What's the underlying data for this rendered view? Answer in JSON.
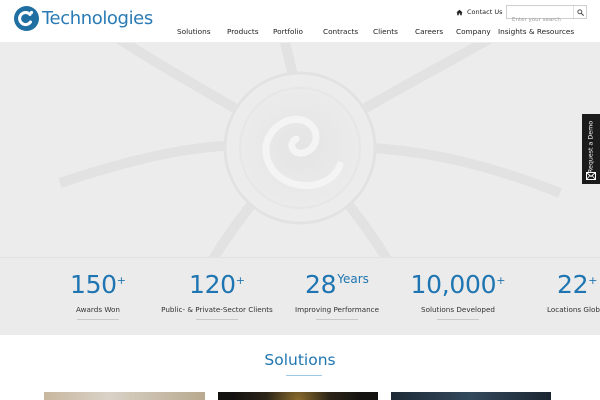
{
  "brand": {
    "name": "Technologies",
    "logo_icon": "ci-logo-mark",
    "color": "#2a7bb5"
  },
  "utility": {
    "contact_label": "Contact Us",
    "search_placeholder": "Enter your search",
    "search_icon": "magnifier"
  },
  "nav": {
    "items": [
      "Solutions",
      "Products",
      "Portfolio",
      "Contracts",
      "Clients",
      "Careers",
      "Company",
      "Insights & Resources"
    ]
  },
  "hero": {
    "background": "#ececec",
    "graphic": "turbine-fan-with-swirl"
  },
  "demo_tab": {
    "label": "Request a Demo",
    "icon": "mail-icon"
  },
  "stats": [
    {
      "number": "150",
      "suffix": "+",
      "label": "Awards Won"
    },
    {
      "number": "120",
      "suffix": "+",
      "label": "Public- & Private-Sector Clients"
    },
    {
      "number": "28",
      "suffix": "Years",
      "label": "Improving Performance"
    },
    {
      "number": "10,000",
      "suffix": "+",
      "label": "Solutions Developed"
    },
    {
      "number": "22",
      "suffix": "+",
      "label": "Locations Glob"
    }
  ],
  "solutions": {
    "title": "Solutions"
  },
  "colors": {
    "accent": "#1f75b1",
    "stats_band": "#ebebeb",
    "demo_tab": "#1b1b1b"
  }
}
